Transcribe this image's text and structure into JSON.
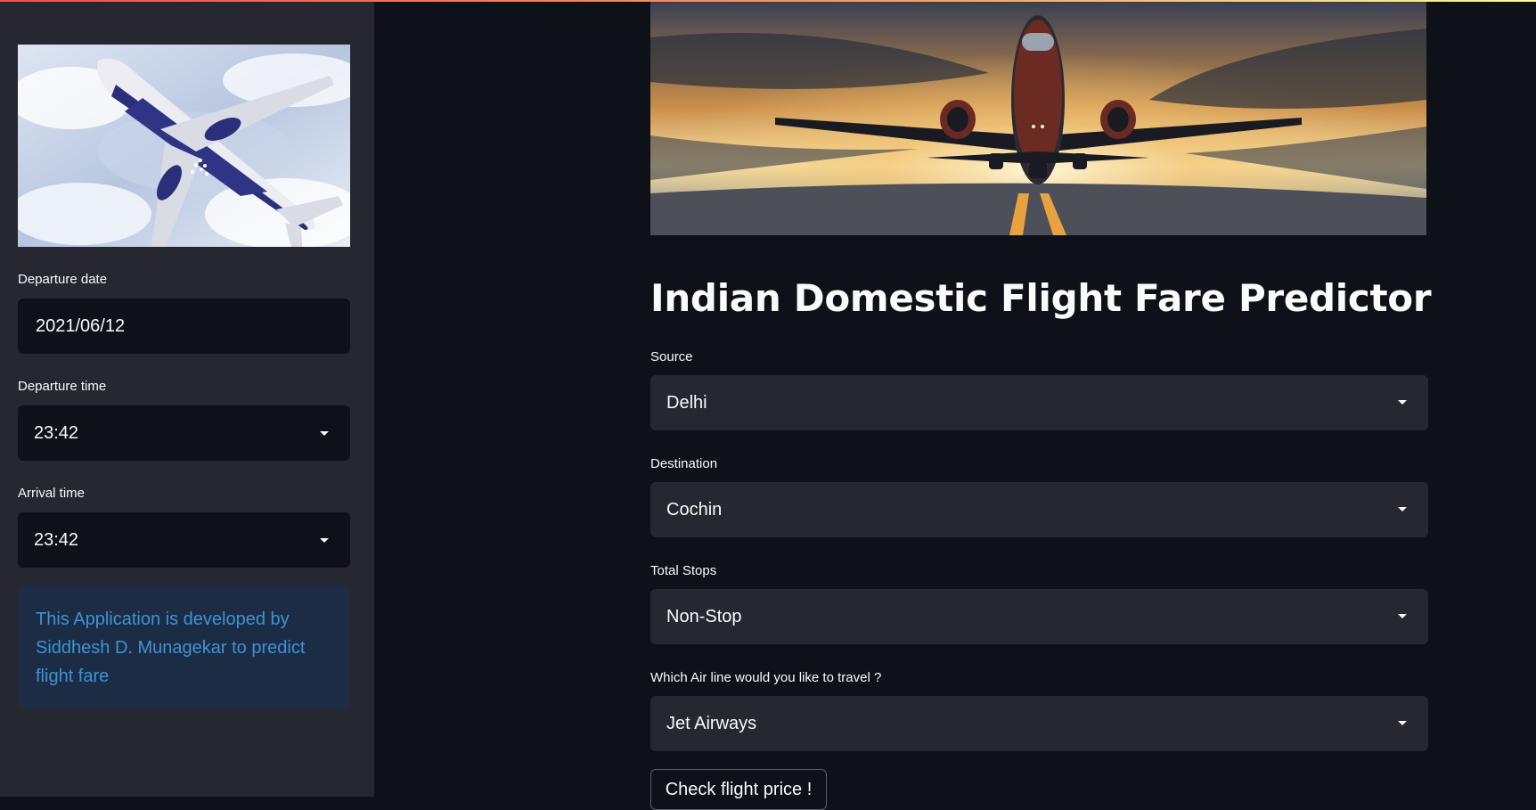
{
  "sidebar": {
    "image_label": "IndiGo airplane flying in cloudy sky",
    "departure_date": {
      "label": "Departure date",
      "value": "2021/06/12"
    },
    "departure_time": {
      "label": "Departure time",
      "value": "23:42"
    },
    "arrival_time": {
      "label": "Arrival time",
      "value": "23:42"
    },
    "info_text": "This Application is developed by Siddhesh D. Munagekar to predict flight fare"
  },
  "main": {
    "title": "Indian Domestic Flight Fare Predictor",
    "source": {
      "label": "Source",
      "value": "Delhi"
    },
    "destination": {
      "label": "Destination",
      "value": "Cochin"
    },
    "total_stops": {
      "label": "Total Stops",
      "value": "Non-Stop"
    },
    "airline": {
      "label": "Which Air line would you like to travel ?",
      "value": "Jet Airways"
    },
    "check_button": "Check flight price !"
  },
  "colors": {
    "background": "#0e1117",
    "sidebar": "#262730",
    "info_bg": "#1c2c45",
    "info_text": "#3d93d6",
    "accent_gradient_start": "#ff4b4b"
  },
  "icons": {
    "dropdown": "chevron-down-icon"
  }
}
